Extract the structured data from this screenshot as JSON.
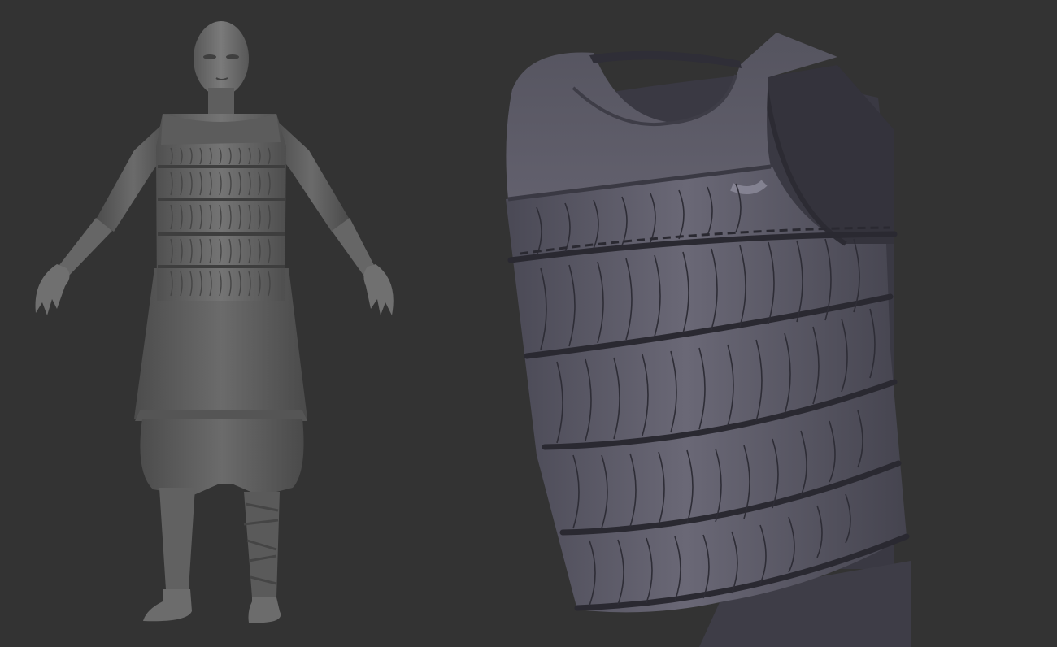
{
  "scene": {
    "background_color": "#333333",
    "views": [
      {
        "id": "full-body",
        "content": "character-model"
      },
      {
        "id": "closeup",
        "content": "armor-vest"
      }
    ]
  },
  "colors": {
    "figure_clay": "#6e6e6e",
    "figure_shadow": "#4a4a4a",
    "armor_clay": "#5f5d6a",
    "armor_shadow": "#3e3d47",
    "armor_highlight": "#8c8a99"
  }
}
